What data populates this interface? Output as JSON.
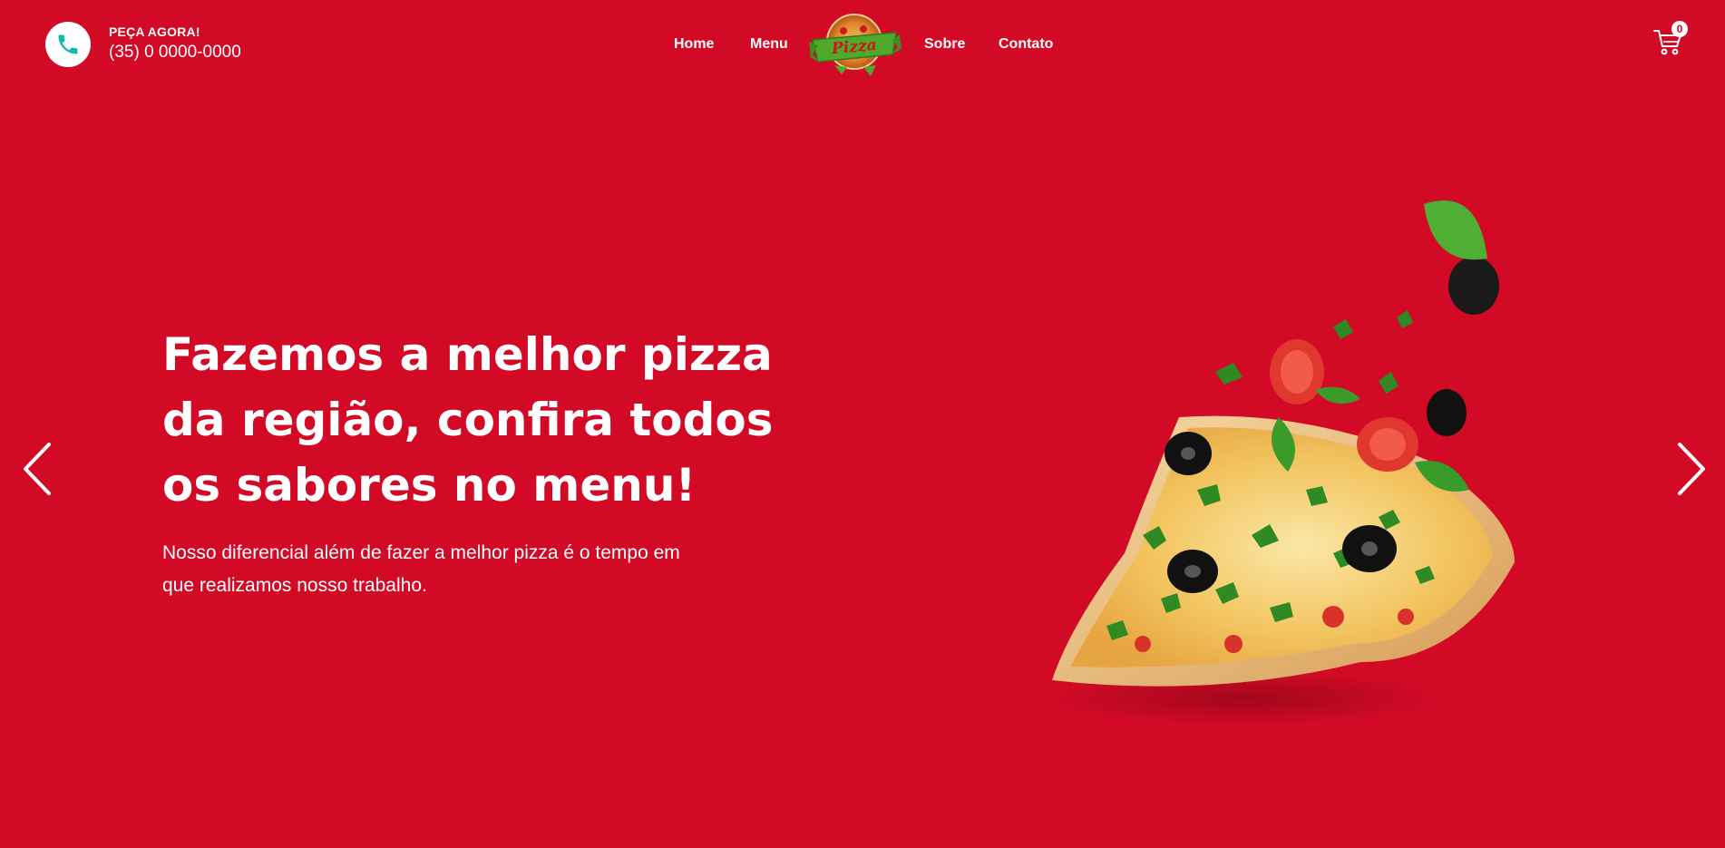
{
  "header": {
    "phone_cta": "PEÇA AGORA!",
    "phone_number": "(35) 0 0000-0000",
    "nav": {
      "home": "Home",
      "menu": "Menu",
      "about": "Sobre",
      "contact": "Contato"
    },
    "logo_text": "Pizza",
    "cart_count": "0"
  },
  "hero": {
    "title": "Fazemos a melhor pizza da região, confira todos os sabores no menu!",
    "subtitle": "Nosso diferencial além de fazer a melhor pizza é o tempo em que realizamos nosso trabalho."
  },
  "colors": {
    "background": "#d20a26",
    "phone_icon": "#12b9a6",
    "text": "#ffffff"
  },
  "icons": {
    "phone": "phone-icon",
    "cart": "cart-icon",
    "prev": "chevron-left-icon",
    "next": "chevron-right-icon"
  }
}
